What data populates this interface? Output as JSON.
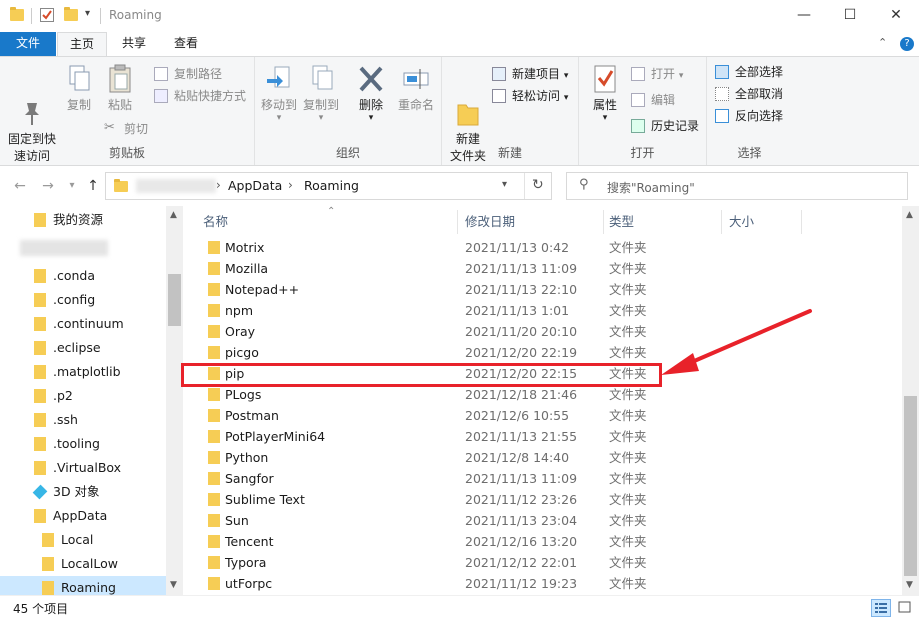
{
  "window": {
    "title": "Roaming",
    "minimize_glyph": "—",
    "maximize_glyph": "☐",
    "close_glyph": "✕"
  },
  "tabs": [
    {
      "label": "文件"
    },
    {
      "label": "主页"
    },
    {
      "label": "共享"
    },
    {
      "label": "查看"
    }
  ],
  "ribbon": {
    "clipboard": {
      "label": "剪贴板",
      "pin": "固定到快\n速访问",
      "copy": "复制",
      "paste": "粘贴",
      "copy_path": "复制路径",
      "paste_shortcut": "粘贴快捷方式",
      "cut": "剪切"
    },
    "organize": {
      "label": "组织",
      "move_to": "移动到",
      "copy_to": "复制到",
      "delete": "删除",
      "rename": "重命名"
    },
    "new": {
      "label": "新建",
      "new_folder": "新建\n文件夹",
      "new_item": "新建项目",
      "easy_access": "轻松访问"
    },
    "open": {
      "label": "打开",
      "properties": "属性",
      "open": "打开",
      "edit": "编辑",
      "history": "历史记录"
    },
    "select": {
      "label": "选择",
      "select_all": "全部选择",
      "select_none": "全部取消",
      "invert": "反向选择"
    }
  },
  "address": {
    "crumbs": [
      "AppData",
      "Roaming"
    ],
    "search_placeholder": "搜索\"Roaming\""
  },
  "tree": [
    {
      "label": "我的资源",
      "type": "folder",
      "indent": 0
    },
    {
      "label": ".conda",
      "type": "folder",
      "indent": 0
    },
    {
      "label": ".config",
      "type": "folder",
      "indent": 0
    },
    {
      "label": ".continuum",
      "type": "folder",
      "indent": 0
    },
    {
      "label": ".eclipse",
      "type": "folder",
      "indent": 0
    },
    {
      "label": ".matplotlib",
      "type": "folder",
      "indent": 0
    },
    {
      "label": ".p2",
      "type": "folder",
      "indent": 0
    },
    {
      "label": ".ssh",
      "type": "folder",
      "indent": 0
    },
    {
      "label": ".tooling",
      "type": "folder",
      "indent": 0
    },
    {
      "label": ".VirtualBox",
      "type": "folder",
      "indent": 0
    },
    {
      "label": "3D 对象",
      "type": "3d",
      "indent": 0
    },
    {
      "label": "AppData",
      "type": "folder",
      "indent": 0
    },
    {
      "label": "Local",
      "type": "folder",
      "indent": 1
    },
    {
      "label": "LocalLow",
      "type": "folder",
      "indent": 1
    },
    {
      "label": "Roaming",
      "type": "folder",
      "indent": 1,
      "selected": true
    }
  ],
  "columns": {
    "name": "名称",
    "date": "修改日期",
    "type": "类型",
    "size": "大小"
  },
  "files": [
    {
      "name": "Motrix",
      "date": "2021/11/13 0:42",
      "type": "文件夹"
    },
    {
      "name": "Mozilla",
      "date": "2021/11/13 11:09",
      "type": "文件夹"
    },
    {
      "name": "Notepad++",
      "date": "2021/11/13 22:10",
      "type": "文件夹"
    },
    {
      "name": "npm",
      "date": "2021/11/13 1:01",
      "type": "文件夹"
    },
    {
      "name": "Oray",
      "date": "2021/11/20 20:10",
      "type": "文件夹"
    },
    {
      "name": "picgo",
      "date": "2021/12/20 22:19",
      "type": "文件夹"
    },
    {
      "name": "pip",
      "date": "2021/12/20 22:15",
      "type": "文件夹",
      "highlighted": true
    },
    {
      "name": "PLogs",
      "date": "2021/12/18 21:46",
      "type": "文件夹"
    },
    {
      "name": "Postman",
      "date": "2021/12/6 10:55",
      "type": "文件夹"
    },
    {
      "name": "PotPlayerMini64",
      "date": "2021/11/13 21:55",
      "type": "文件夹"
    },
    {
      "name": "Python",
      "date": "2021/12/8 14:40",
      "type": "文件夹"
    },
    {
      "name": "Sangfor",
      "date": "2021/11/13 11:09",
      "type": "文件夹"
    },
    {
      "name": "Sublime Text",
      "date": "2021/11/12 23:26",
      "type": "文件夹"
    },
    {
      "name": "Sun",
      "date": "2021/11/13 23:04",
      "type": "文件夹"
    },
    {
      "name": "Tencent",
      "date": "2021/12/16 13:20",
      "type": "文件夹"
    },
    {
      "name": "Typora",
      "date": "2021/12/12 22:01",
      "type": "文件夹"
    },
    {
      "name": "utForpc",
      "date": "2021/11/12 19:23",
      "type": "文件夹"
    }
  ],
  "status": {
    "count": "45 个项目"
  },
  "colors": {
    "file_tab": "#1979ca",
    "folder": "#f6cd55",
    "annotation": "#e8222a",
    "selection": "#cce8ff"
  }
}
